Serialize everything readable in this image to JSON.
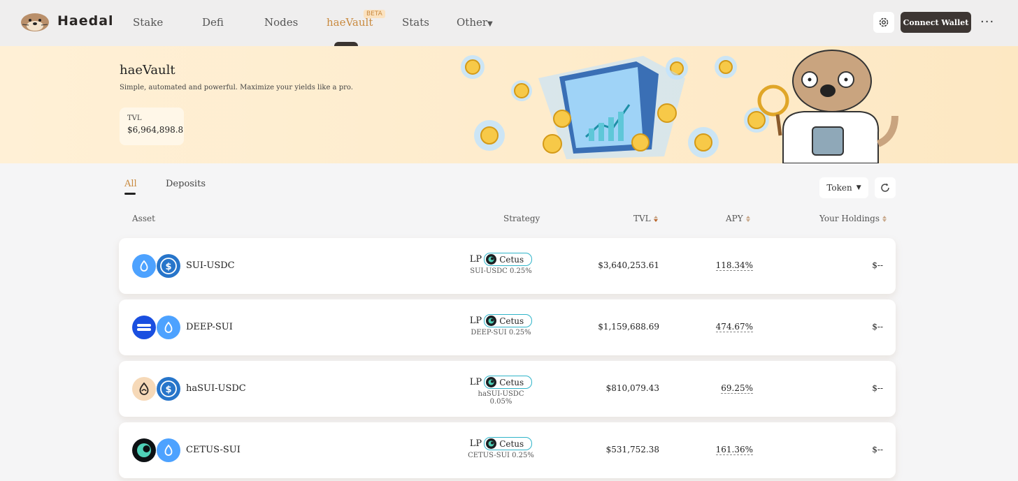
{
  "nav": {
    "brand": "Haedal",
    "items": [
      {
        "label": "Stake"
      },
      {
        "label": "Defi"
      },
      {
        "label": "Nodes"
      },
      {
        "label": "haeVault"
      },
      {
        "label": "Stats"
      },
      {
        "label": "Other"
      }
    ],
    "active_item": "haeVault",
    "beta_badge": "BETA",
    "connect_wallet": "Connect Wallet",
    "more": "···"
  },
  "banner": {
    "title": "haeVault",
    "subtitle": "Simple, automated and powerful. Maximize your yields like a pro.",
    "tvl_label": "TVL",
    "tvl_value": "$6,964,898.8"
  },
  "tabs": [
    {
      "label": "All",
      "active": true
    },
    {
      "label": "Deposits",
      "active": false
    }
  ],
  "filter": {
    "label": "Token"
  },
  "table": {
    "headers": {
      "asset": "Asset",
      "strategy": "Strategy",
      "tvl": "TVL",
      "apy": "APY",
      "holdings": "Your Holdings"
    },
    "rows": [
      {
        "name": "SUI-USDC",
        "lp": "LP",
        "protocol": "Cetus",
        "pool": "SUI-USDC 0.25%",
        "tvl": "$3,640,253.61",
        "apy": "118.34%",
        "holdings": "$--",
        "icons": [
          "sui-icon",
          "usdc-icon"
        ]
      },
      {
        "name": "DEEP-SUI",
        "lp": "LP",
        "protocol": "Cetus",
        "pool": "DEEP-SUI 0.25%",
        "tvl": "$1,159,688.69",
        "apy": "474.67%",
        "holdings": "$--",
        "icons": [
          "deep-icon",
          "sui-icon"
        ]
      },
      {
        "name": "haSUI-USDC",
        "lp": "LP",
        "protocol": "Cetus",
        "pool": "haSUI-USDC 0.05%",
        "tvl": "$810,079.43",
        "apy": "69.25%",
        "holdings": "$--",
        "icons": [
          "hasui-icon",
          "usdc-icon"
        ]
      },
      {
        "name": "CETUS-SUI",
        "lp": "LP",
        "protocol": "Cetus",
        "pool": "CETUS-SUI 0.25%",
        "tvl": "$531,752.38",
        "apy": "161.36%",
        "holdings": "$--",
        "icons": [
          "cetus-icon",
          "sui-icon"
        ]
      }
    ]
  },
  "colors": {
    "accent": "#c98a3f",
    "banner_bg": "#fde8c3",
    "nav_bg": "#efeeee",
    "connect_btn": "#3d3633",
    "cetus_border": "#2fb4c9",
    "sui_blue": "#4da2ff",
    "usdc_blue": "#2775ca"
  }
}
